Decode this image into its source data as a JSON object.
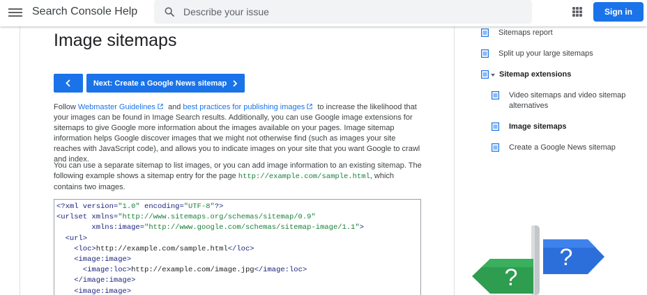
{
  "header": {
    "app_title": "Search Console Help",
    "search_placeholder": "Describe your issue",
    "signin_label": "Sign in"
  },
  "main": {
    "title": "Image sitemaps",
    "next_button": "Next: Create a Google News sitemap",
    "para1": {
      "t1": "Follow ",
      "link1": "Webmaster Guidelines",
      "t2": " and ",
      "link2": "best practices for publishing images",
      "t3": " to increase the likelihood that your images can be found in Image Search results. Additionally, you can use Google image extensions for sitemaps to give Google more information about the images available on your pages. Image sitemap information helps Google discover images that we might not otherwise find (such as images your site reaches with JavaScript code), and allows you to indicate images on your site that you want Google to crawl and index."
    },
    "para2": {
      "t1": "You can use a separate sitemap to list images, or you can add image information to an existing sitemap. The following example shows a sitemap entry for the page ",
      "code": "http://example.com/sample.html",
      "t2": ", which contains two images."
    },
    "code": {
      "l1a": "<?xml version=",
      "l1b": "\"1.0\"",
      "l1c": " encoding=",
      "l1d": "\"UTF-8\"",
      "l1e": "?>",
      "l2a": "<urlset xmlns=",
      "l2b": "\"http://www.sitemaps.org/schemas/sitemap/0.9\"",
      "l3a": "        xmlns:image=",
      "l3b": "\"http://www.google.com/schemas/sitemap-image/1.1\"",
      "l3c": ">",
      "l4": "  <url>",
      "l5a": "    <loc>",
      "l5b": "http://example.com/sample.html",
      "l5c": "</loc>",
      "l6": "    <image:image>",
      "l7a": "      <image:loc>",
      "l7b": "http://example.com/image.jpg",
      "l7c": "</image:loc>",
      "l8": "    </image:image>",
      "l9": "    <image:image>"
    }
  },
  "sidebar": {
    "items": [
      {
        "label": "Sitemaps report"
      },
      {
        "label": "Split up your large sitemaps"
      },
      {
        "label": "Sitemap extensions"
      },
      {
        "label": "Video sitemaps and video sitemap alternatives"
      },
      {
        "label": "Image sitemaps"
      },
      {
        "label": "Create a Google News sitemap"
      }
    ]
  },
  "signpost": {
    "left_glyph": "?",
    "right_glyph": "?"
  },
  "colors": {
    "accent": "#1a73e8",
    "sign_green": "#2e9d4f",
    "sign_blue": "#2c6fdb"
  }
}
